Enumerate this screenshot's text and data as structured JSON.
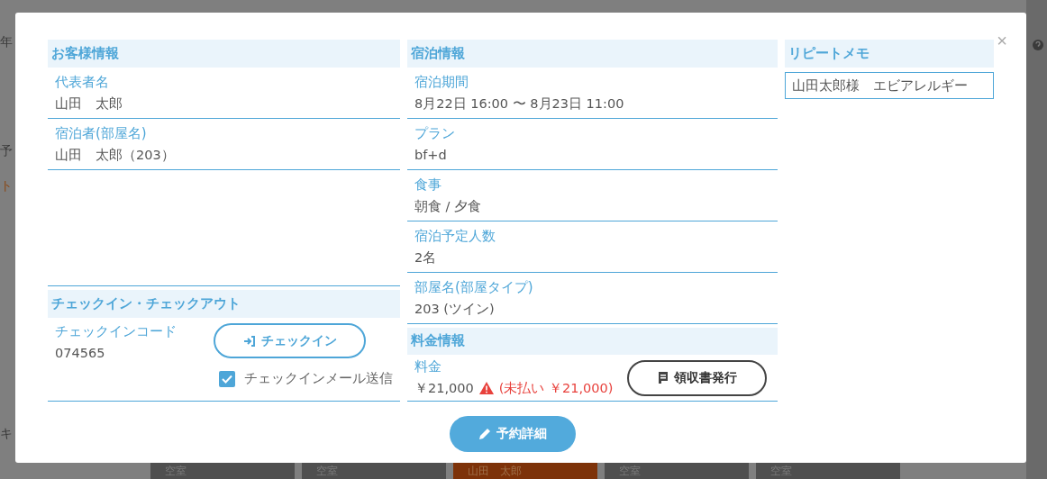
{
  "background": {
    "side_labels": [
      {
        "text": "年",
        "kind": "plain"
      },
      {
        "text": "予",
        "kind": "plain"
      },
      {
        "text": "ト",
        "kind": "accent"
      },
      {
        "text": "キ",
        "kind": "plain"
      }
    ],
    "rooms": [
      {
        "label": "空室",
        "kind": "vacant"
      },
      {
        "label": "空室",
        "kind": "vacant"
      },
      {
        "label": "山田　太郎",
        "kind": "occupied"
      },
      {
        "label": "空室",
        "kind": "vacant"
      },
      {
        "label": "空室",
        "kind": "vacant"
      }
    ]
  },
  "modal": {
    "close": "×",
    "guest": {
      "title": "お客様情報",
      "fields": [
        {
          "label": "代表者名",
          "value": "山田　太郎"
        },
        {
          "label": "宿泊者(部屋名)",
          "value": "山田　太郎（203）"
        }
      ]
    },
    "checkin": {
      "title": "チェックイン・チェックアウト",
      "code_label": "チェックインコード",
      "code": "074565",
      "button": "チェックイン",
      "mail": {
        "label": "チェックインメール送信",
        "checked": true
      }
    },
    "stay": {
      "title": "宿泊情報",
      "fields": [
        {
          "label": "宿泊期間",
          "value": "8月22日 16:00 〜 8月23日 11:00"
        },
        {
          "label": "プラン",
          "value": "bf+d"
        },
        {
          "label": "食事",
          "value": "朝食 / 夕食"
        },
        {
          "label": "宿泊予定人数",
          "value": "2名"
        },
        {
          "label": "部屋名(部屋タイプ)",
          "value": "203 (ツイン)"
        }
      ]
    },
    "fee": {
      "title": "料金情報",
      "label": "料金",
      "amount": "￥21,000",
      "unpaid": "(未払い ￥21,000)",
      "receipt_button": "領収書発行"
    },
    "memo": {
      "title": "リピートメモ",
      "value": "山田太郎様　エビアレルギー"
    },
    "detail_button": "予約詳細"
  }
}
